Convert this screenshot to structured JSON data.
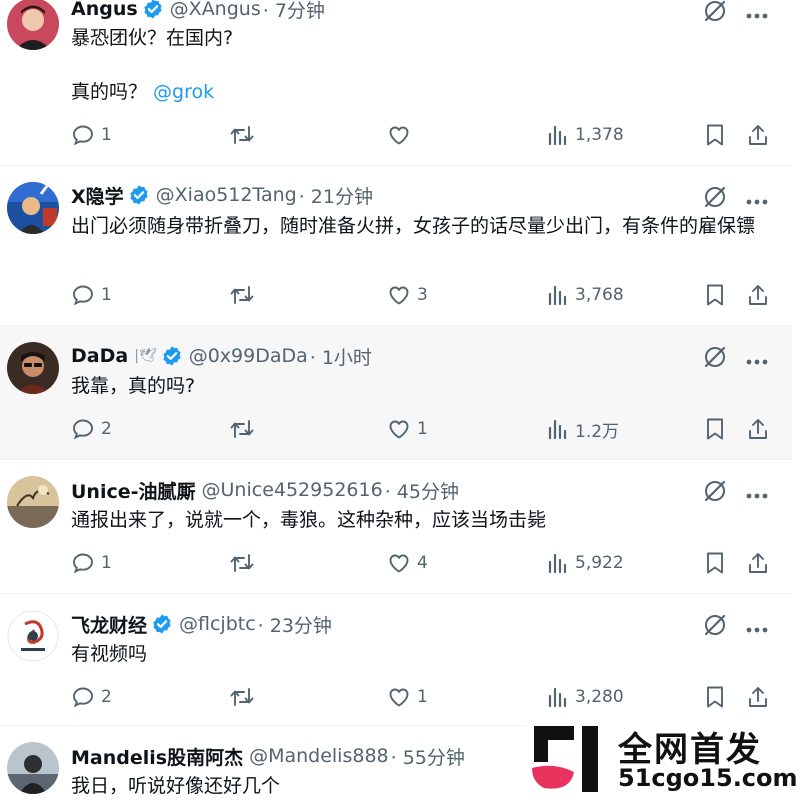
{
  "tweets": [
    {
      "name": "Angus",
      "verified": true,
      "handle": "@XAngus",
      "time": "· 7分钟",
      "text": "暴恐团伙？在国内?",
      "text2": "真的吗？",
      "mention": "@grok",
      "replies": "1",
      "likes": "",
      "views": "1,378"
    },
    {
      "name": "X隐学",
      "verified": true,
      "handle": "@Xiao512Tang",
      "time": "· 21分钟",
      "text": "出门必须随身带折叠刀，随时准备火拼，女孩子的话尽量少出门，有条件的雇保镖",
      "replies": "1",
      "likes": "3",
      "views": "3,768"
    },
    {
      "name": "DaDa",
      "name_suffix": "|🕊",
      "verified": true,
      "handle": "@0x99DaDa",
      "time": "· 1小时",
      "text": "我靠，真的吗?",
      "replies": "2",
      "likes": "1",
      "views": "1.2万"
    },
    {
      "name": "Unice-油腻厮",
      "verified": false,
      "handle": "@Unice452952616",
      "time": "· 45分钟",
      "text": "通报出来了，说就一个，毒狼。这种杂种，应该当场击毙",
      "replies": "1",
      "likes": "4",
      "views": "5,922"
    },
    {
      "name": "飞龙财经",
      "verified": true,
      "handle": "@flcjbtc",
      "time": "· 23分钟",
      "text": "有视频吗",
      "replies": "2",
      "likes": "1",
      "views": "3,280"
    },
    {
      "name": "Mandelis股南阿杰",
      "verified": false,
      "handle": "@Mandelis888",
      "time": "· 55分钟",
      "text": "我日，听说好像还好几个"
    }
  ],
  "watermark": {
    "title": "全网首发",
    "url": "51cgo15.com"
  },
  "colors": {
    "accent": "#1d9bf0",
    "muted": "#536471",
    "highlight_bg": "#f7f7f7"
  }
}
